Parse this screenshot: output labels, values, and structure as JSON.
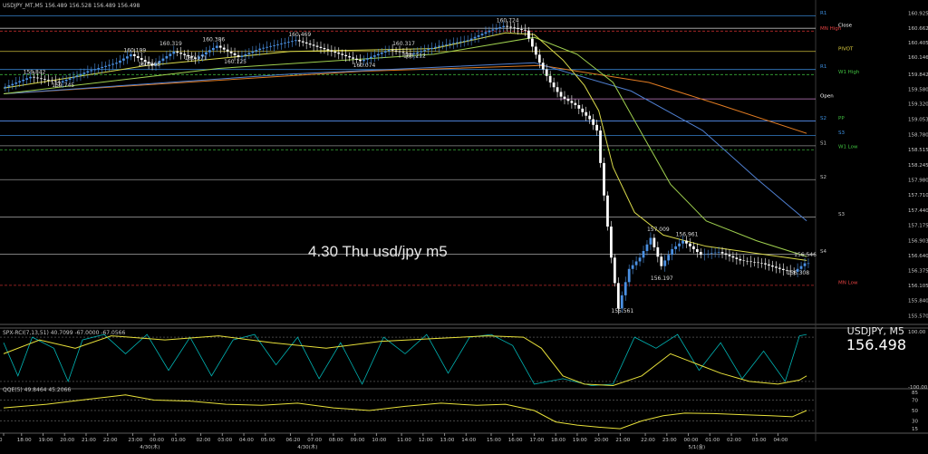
{
  "header": {
    "symbol_line": "USDJPY_MT,M5  156.489 156.528 156.489 156.498",
    "ind1_line": "SPX-RCI(7,13,51) 40.7099 -67.0000 -67.0566",
    "ind2_line": "QQE(5) 49.8464 45.2066"
  },
  "overlay": {
    "chart_title": "4.30 Thu usd/jpy m5",
    "symbol_tf": "USDJPY, M5",
    "last_price": "156.498"
  },
  "colors": {
    "bg": "#000000",
    "grid": "#1b1b1b",
    "candle_up": "#4a90e2",
    "candle_dn": "#ffffff",
    "ma_fast": "#d9d94a",
    "ma_slow": "#9fd04f",
    "ma_long": "#4f7fd0",
    "ma_200": "#e07b22",
    "rci_short": "#00b5b5",
    "rci_long": "#e8e13a",
    "qqe": "#e8e13a"
  },
  "price_axis": [
    {
      "label": "160.925",
      "v": 160.925
    },
    {
      "label": "160.662",
      "v": 160.662
    },
    {
      "label": "160.405",
      "v": 160.405
    },
    {
      "label": "160.146",
      "v": 160.146
    },
    {
      "label": "159.842",
      "v": 159.842
    },
    {
      "label": "159.580",
      "v": 159.58
    },
    {
      "label": "159.320",
      "v": 159.32
    },
    {
      "label": "159.053",
      "v": 159.053
    },
    {
      "label": "158.780",
      "v": 158.78
    },
    {
      "label": "158.515",
      "v": 158.515
    },
    {
      "label": "158.245",
      "v": 158.245
    },
    {
      "label": "157.980",
      "v": 157.98
    },
    {
      "label": "157.710",
      "v": 157.71
    },
    {
      "label": "157.440",
      "v": 157.44
    },
    {
      "label": "157.175",
      "v": 157.175
    },
    {
      "label": "156.903",
      "v": 156.903
    },
    {
      "label": "156.640",
      "v": 156.64
    },
    {
      "label": "156.375",
      "v": 156.375
    },
    {
      "label": "156.105",
      "v": 156.105
    },
    {
      "label": "155.840",
      "v": 155.84
    },
    {
      "label": "155.570",
      "v": 155.57
    }
  ],
  "levels": [
    {
      "name": "R1",
      "v": 160.88,
      "color": "#3c8fe0",
      "dash": false,
      "label_color": "#3c8fe0"
    },
    {
      "name": "Close",
      "v": 160.66,
      "color": "#d0d0d0",
      "dash": false,
      "label_color": "#ffffff"
    },
    {
      "name": "MN High",
      "v": 160.61,
      "color": "#d03030",
      "dash": true,
      "label_color": "#e04040"
    },
    {
      "name": "PIVOT",
      "v": 160.25,
      "color": "#e0d040",
      "dash": false,
      "label_color": "#e0d040"
    },
    {
      "name": "R1",
      "v": 159.93,
      "color": "#3c8fe0",
      "dash": false,
      "label_color": "#3c8fe0"
    },
    {
      "name": "W1 High",
      "v": 159.84,
      "color": "#40c040",
      "dash": true,
      "label_color": "#40c040"
    },
    {
      "name": "Open",
      "v": 159.41,
      "color": "#e090e0",
      "dash": false,
      "label_color": "#ffffff"
    },
    {
      "name": "PP",
      "v": 159.02,
      "color": "#c060e0",
      "dash": false,
      "label_color": "#40c040"
    },
    {
      "name": "S2",
      "v": 159.02,
      "color": "#3c8fe0",
      "dash": false,
      "label_color": "#3c8fe0"
    },
    {
      "name": "S3",
      "v": 158.76,
      "color": "#3c8fe0",
      "dash": false,
      "label_color": "#3c8fe0"
    },
    {
      "name": "S1",
      "v": 158.58,
      "color": "#a0a0a0",
      "dash": false,
      "label_color": "#c0c0c0"
    },
    {
      "name": "W1 Low",
      "v": 158.51,
      "color": "#40c040",
      "dash": true,
      "label_color": "#40c040"
    },
    {
      "name": "S2",
      "v": 157.98,
      "color": "#a0a0a0",
      "dash": false,
      "label_color": "#c0c0c0"
    },
    {
      "name": "S3",
      "v": 157.32,
      "color": "#a0a0a0",
      "dash": false,
      "label_color": "#c0c0c0"
    },
    {
      "name": "S4",
      "v": 156.66,
      "color": "#a0a0a0",
      "dash": false,
      "label_color": "#c0c0c0"
    },
    {
      "name": "MN Low",
      "v": 156.11,
      "color": "#d03030",
      "dash": true,
      "label_color": "#e04040"
    }
  ],
  "price_annotations": [
    {
      "label": "159.842",
      "i": 8,
      "v": 159.85
    },
    {
      "label": "159.745",
      "i": 16,
      "v": 159.62
    },
    {
      "label": "160.199",
      "i": 36,
      "v": 160.24
    },
    {
      "label": "160.319",
      "i": 46,
      "v": 160.36
    },
    {
      "label": "160.386",
      "i": 58,
      "v": 160.43
    },
    {
      "label": "160.469",
      "i": 82,
      "v": 160.52
    },
    {
      "label": "160.065",
      "i": 40,
      "v": 159.99
    },
    {
      "label": "160.171",
      "i": 53,
      "v": 160.1
    },
    {
      "label": "160.125",
      "i": 64,
      "v": 160.04
    },
    {
      "label": "160.317",
      "i": 111,
      "v": 160.36
    },
    {
      "label": "160.074",
      "i": 100,
      "v": 159.97
    },
    {
      "label": "160.212",
      "i": 114,
      "v": 160.14
    },
    {
      "label": "160.724",
      "i": 140,
      "v": 160.77
    },
    {
      "label": "157.009",
      "i": 182,
      "v": 157.07
    },
    {
      "label": "156.961",
      "i": 190,
      "v": 156.98
    },
    {
      "label": "156.197",
      "i": 183,
      "v": 156.2
    },
    {
      "label": "155.561",
      "i": 172,
      "v": 155.63
    },
    {
      "label": "156.546",
      "i": 223,
      "v": 156.62
    },
    {
      "label": "156.308",
      "i": 221,
      "v": 156.3
    }
  ],
  "time_axis": [
    {
      "label": "0",
      "i": 0
    },
    {
      "label": "18:00",
      "i": 5
    },
    {
      "label": "19:00",
      "i": 11
    },
    {
      "label": "20:00",
      "i": 17
    },
    {
      "label": "21:00",
      "i": 23
    },
    {
      "label": "22:00",
      "i": 29
    },
    {
      "label": "23:00",
      "i": 36
    },
    {
      "label": "00:00",
      "i": 42
    },
    {
      "label": "01:00",
      "i": 48
    },
    {
      "label": "02:00",
      "i": 55
    },
    {
      "label": "03:00",
      "i": 61
    },
    {
      "label": "04:00",
      "i": 67
    },
    {
      "label": "05:00",
      "i": 73
    },
    {
      "label": "06:20",
      "i": 80
    },
    {
      "label": "07:00",
      "i": 86
    },
    {
      "label": "08:00",
      "i": 92
    },
    {
      "label": "09:00",
      "i": 98
    },
    {
      "label": "10:00",
      "i": 104
    },
    {
      "label": "11:00",
      "i": 111
    },
    {
      "label": "12:00",
      "i": 117
    },
    {
      "label": "13:00",
      "i": 123
    },
    {
      "label": "14:00",
      "i": 129
    },
    {
      "label": "15:00",
      "i": 136
    },
    {
      "label": "16:00",
      "i": 142
    },
    {
      "label": "17:00",
      "i": 148
    },
    {
      "label": "18:00",
      "i": 154
    },
    {
      "label": "19:00",
      "i": 160
    },
    {
      "label": "20:00",
      "i": 166
    },
    {
      "label": "21:00",
      "i": 172
    },
    {
      "label": "22:00",
      "i": 179
    },
    {
      "label": "23:00",
      "i": 185
    },
    {
      "label": "00:00",
      "i": 191
    },
    {
      "label": "01:00",
      "i": 197
    },
    {
      "label": "02:00",
      "i": 203
    },
    {
      "label": "03:00",
      "i": 210
    },
    {
      "label": "04:00",
      "i": 216
    }
  ],
  "date_labels": [
    {
      "label": "4/30(木)",
      "i": 40
    },
    {
      "label": "4/30(木)",
      "i": 84
    },
    {
      "label": "5/1(金)",
      "i": 193
    }
  ],
  "ind1_axis": [
    {
      "label": "100.00",
      "v": 100
    },
    {
      "label": "-100.00",
      "v": -100
    }
  ],
  "ind2_axis": [
    {
      "label": "85",
      "v": 85
    },
    {
      "label": "70",
      "v": 70
    },
    {
      "label": "50",
      "v": 50
    },
    {
      "label": "30",
      "v": 30
    },
    {
      "label": "15",
      "v": 15
    }
  ],
  "chart_data": {
    "type": "candlestick",
    "symbol": "USDJPY",
    "timeframe": "M5",
    "ylim": [
      155.45,
      161.0
    ],
    "shape": [
      {
        "i": 0,
        "v": 159.6
      },
      {
        "i": 8,
        "v": 159.8
      },
      {
        "i": 16,
        "v": 159.7
      },
      {
        "i": 24,
        "v": 159.9
      },
      {
        "i": 32,
        "v": 160.05
      },
      {
        "i": 36,
        "v": 160.2
      },
      {
        "i": 42,
        "v": 160.0
      },
      {
        "i": 48,
        "v": 160.25
      },
      {
        "i": 54,
        "v": 160.12
      },
      {
        "i": 60,
        "v": 160.35
      },
      {
        "i": 66,
        "v": 160.15
      },
      {
        "i": 72,
        "v": 160.3
      },
      {
        "i": 82,
        "v": 160.45
      },
      {
        "i": 92,
        "v": 160.25
      },
      {
        "i": 100,
        "v": 160.08
      },
      {
        "i": 108,
        "v": 160.28
      },
      {
        "i": 114,
        "v": 160.2
      },
      {
        "i": 122,
        "v": 160.35
      },
      {
        "i": 130,
        "v": 160.45
      },
      {
        "i": 136,
        "v": 160.62
      },
      {
        "i": 140,
        "v": 160.7
      },
      {
        "i": 146,
        "v": 160.62
      },
      {
        "i": 150,
        "v": 160.05
      },
      {
        "i": 153,
        "v": 159.7
      },
      {
        "i": 156,
        "v": 159.45
      },
      {
        "i": 160,
        "v": 159.3
      },
      {
        "i": 164,
        "v": 159.05
      },
      {
        "i": 166,
        "v": 158.85
      },
      {
        "i": 168,
        "v": 157.7
      },
      {
        "i": 170,
        "v": 156.6
      },
      {
        "i": 172,
        "v": 155.7
      },
      {
        "i": 175,
        "v": 156.4
      },
      {
        "i": 178,
        "v": 156.6
      },
      {
        "i": 181,
        "v": 156.95
      },
      {
        "i": 184,
        "v": 156.45
      },
      {
        "i": 187,
        "v": 156.75
      },
      {
        "i": 190,
        "v": 156.9
      },
      {
        "i": 195,
        "v": 156.65
      },
      {
        "i": 200,
        "v": 156.7
      },
      {
        "i": 206,
        "v": 156.55
      },
      {
        "i": 212,
        "v": 156.5
      },
      {
        "i": 218,
        "v": 156.38
      },
      {
        "i": 221,
        "v": 156.35
      },
      {
        "i": 224,
        "v": 156.5
      }
    ],
    "ma_fast": [
      {
        "i": 0,
        "v": 159.6
      },
      {
        "i": 40,
        "v": 160.0
      },
      {
        "i": 80,
        "v": 160.25
      },
      {
        "i": 120,
        "v": 160.3
      },
      {
        "i": 140,
        "v": 160.58
      },
      {
        "i": 148,
        "v": 160.55
      },
      {
        "i": 156,
        "v": 160.1
      },
      {
        "i": 162,
        "v": 159.65
      },
      {
        "i": 166,
        "v": 159.2
      },
      {
        "i": 170,
        "v": 158.2
      },
      {
        "i": 176,
        "v": 157.4
      },
      {
        "i": 184,
        "v": 157.0
      },
      {
        "i": 196,
        "v": 156.8
      },
      {
        "i": 224,
        "v": 156.55
      }
    ],
    "ma_slow": [
      {
        "i": 0,
        "v": 159.5
      },
      {
        "i": 60,
        "v": 159.95
      },
      {
        "i": 120,
        "v": 160.2
      },
      {
        "i": 148,
        "v": 160.5
      },
      {
        "i": 160,
        "v": 160.2
      },
      {
        "i": 170,
        "v": 159.7
      },
      {
        "i": 178,
        "v": 158.8
      },
      {
        "i": 186,
        "v": 157.9
      },
      {
        "i": 196,
        "v": 157.25
      },
      {
        "i": 210,
        "v": 156.9
      },
      {
        "i": 224,
        "v": 156.62
      }
    ],
    "ma_long": [
      {
        "i": 0,
        "v": 159.5
      },
      {
        "i": 80,
        "v": 159.85
      },
      {
        "i": 148,
        "v": 160.05
      },
      {
        "i": 175,
        "v": 159.55
      },
      {
        "i": 195,
        "v": 158.85
      },
      {
        "i": 210,
        "v": 158.0
      },
      {
        "i": 224,
        "v": 157.25
      }
    ],
    "ma_200": [
      {
        "i": 0,
        "v": 159.5
      },
      {
        "i": 100,
        "v": 159.9
      },
      {
        "i": 150,
        "v": 160.0
      },
      {
        "i": 180,
        "v": 159.7
      },
      {
        "i": 200,
        "v": 159.3
      },
      {
        "i": 224,
        "v": 158.8
      }
    ],
    "rci": [
      {
        "i": 0,
        "v": 60
      },
      {
        "i": 4,
        "v": -60
      },
      {
        "i": 8,
        "v": 80
      },
      {
        "i": 14,
        "v": 40
      },
      {
        "i": 18,
        "v": -80
      },
      {
        "i": 22,
        "v": 70
      },
      {
        "i": 28,
        "v": 90
      },
      {
        "i": 34,
        "v": 20
      },
      {
        "i": 40,
        "v": 90
      },
      {
        "i": 46,
        "v": -40
      },
      {
        "i": 52,
        "v": 80
      },
      {
        "i": 58,
        "v": -60
      },
      {
        "i": 64,
        "v": 70
      },
      {
        "i": 70,
        "v": 90
      },
      {
        "i": 76,
        "v": -20
      },
      {
        "i": 82,
        "v": 80
      },
      {
        "i": 88,
        "v": -70
      },
      {
        "i": 94,
        "v": 60
      },
      {
        "i": 100,
        "v": -90
      },
      {
        "i": 106,
        "v": 80
      },
      {
        "i": 112,
        "v": 20
      },
      {
        "i": 118,
        "v": 90
      },
      {
        "i": 124,
        "v": -50
      },
      {
        "i": 130,
        "v": 80
      },
      {
        "i": 136,
        "v": 90
      },
      {
        "i": 142,
        "v": 50
      },
      {
        "i": 148,
        "v": -90
      },
      {
        "i": 156,
        "v": -70
      },
      {
        "i": 164,
        "v": -95
      },
      {
        "i": 170,
        "v": -90
      },
      {
        "i": 176,
        "v": 80
      },
      {
        "i": 182,
        "v": 40
      },
      {
        "i": 188,
        "v": 90
      },
      {
        "i": 194,
        "v": -40
      },
      {
        "i": 200,
        "v": 60
      },
      {
        "i": 206,
        "v": -70
      },
      {
        "i": 212,
        "v": 30
      },
      {
        "i": 218,
        "v": -80
      },
      {
        "i": 222,
        "v": 85
      },
      {
        "i": 224,
        "v": 90
      }
    ],
    "rci_long": [
      {
        "i": 0,
        "v": 20
      },
      {
        "i": 10,
        "v": 70
      },
      {
        "i": 20,
        "v": 40
      },
      {
        "i": 30,
        "v": 85
      },
      {
        "i": 45,
        "v": 70
      },
      {
        "i": 60,
        "v": 85
      },
      {
        "i": 75,
        "v": 60
      },
      {
        "i": 90,
        "v": 40
      },
      {
        "i": 105,
        "v": 65
      },
      {
        "i": 120,
        "v": 75
      },
      {
        "i": 135,
        "v": 85
      },
      {
        "i": 145,
        "v": 80
      },
      {
        "i": 150,
        "v": 40
      },
      {
        "i": 156,
        "v": -60
      },
      {
        "i": 162,
        "v": -90
      },
      {
        "i": 170,
        "v": -95
      },
      {
        "i": 178,
        "v": -60
      },
      {
        "i": 186,
        "v": 20
      },
      {
        "i": 194,
        "v": -20
      },
      {
        "i": 200,
        "v": -50
      },
      {
        "i": 208,
        "v": -80
      },
      {
        "i": 216,
        "v": -90
      },
      {
        "i": 222,
        "v": -75
      },
      {
        "i": 224,
        "v": -60
      }
    ],
    "qqe": [
      {
        "i": 0,
        "v": 55
      },
      {
        "i": 12,
        "v": 62
      },
      {
        "i": 24,
        "v": 72
      },
      {
        "i": 34,
        "v": 80
      },
      {
        "i": 42,
        "v": 70
      },
      {
        "i": 52,
        "v": 68
      },
      {
        "i": 62,
        "v": 62
      },
      {
        "i": 72,
        "v": 60
      },
      {
        "i": 82,
        "v": 64
      },
      {
        "i": 92,
        "v": 55
      },
      {
        "i": 102,
        "v": 50
      },
      {
        "i": 112,
        "v": 58
      },
      {
        "i": 122,
        "v": 64
      },
      {
        "i": 132,
        "v": 60
      },
      {
        "i": 140,
        "v": 62
      },
      {
        "i": 148,
        "v": 50
      },
      {
        "i": 154,
        "v": 28
      },
      {
        "i": 160,
        "v": 22
      },
      {
        "i": 166,
        "v": 18
      },
      {
        "i": 172,
        "v": 15
      },
      {
        "i": 178,
        "v": 30
      },
      {
        "i": 184,
        "v": 40
      },
      {
        "i": 190,
        "v": 45
      },
      {
        "i": 198,
        "v": 44
      },
      {
        "i": 206,
        "v": 42
      },
      {
        "i": 214,
        "v": 40
      },
      {
        "i": 220,
        "v": 38
      },
      {
        "i": 224,
        "v": 50
      }
    ]
  }
}
